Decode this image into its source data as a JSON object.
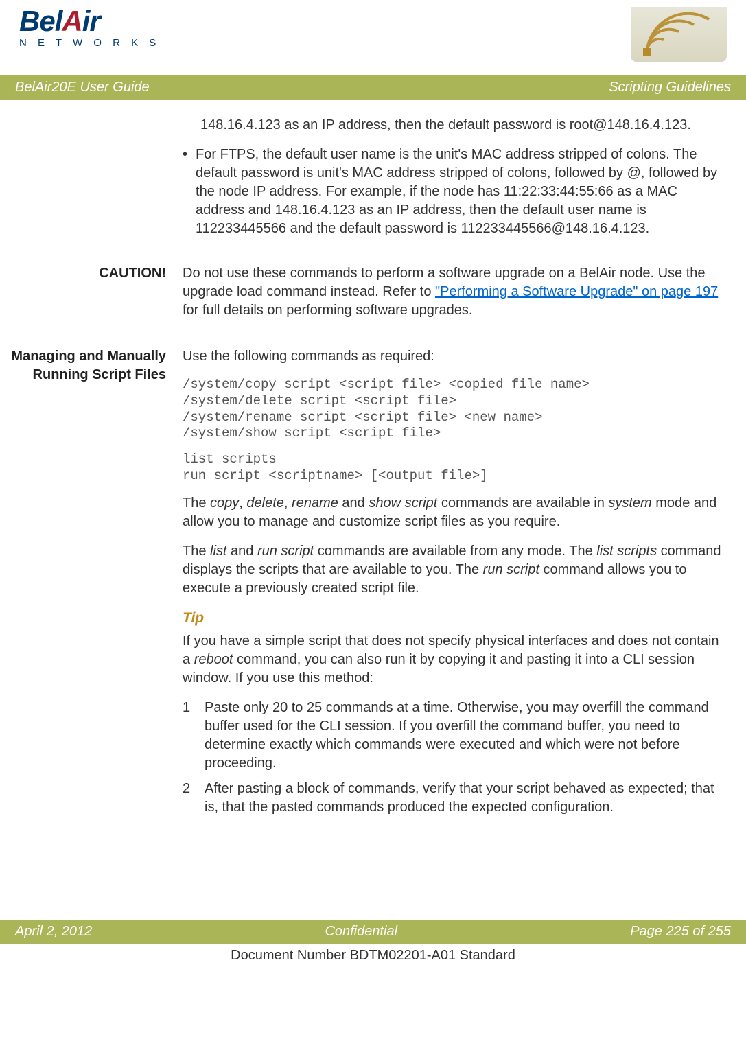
{
  "logo": {
    "main": "BelAir",
    "sub": "N E T W O R K S"
  },
  "titlebar": {
    "left": "BelAir20E User Guide",
    "right": "Scripting Guidelines"
  },
  "intro_para": "148.16.4.123 as an IP address, then the default password is root@148.16.4.123.",
  "ftps_bullet": "For FTPS, the default user name is the unit's MAC address stripped of colons. The default password is unit's MAC address stripped of colons, followed by @, followed by the node IP address. For example, if the node has 11:22:33:44:55:66 as a MAC address and 148.16.4.123 as an IP address, then the default user name is 112233445566 and the default password is 112233445566@148.16.4.123.",
  "caution": {
    "label": "CAUTION!",
    "text_before_link": "Do not use these commands to perform a software upgrade on a BelAir node. Use the upgrade load command instead. Refer to ",
    "link_text": "\"Performing a Software Upgrade\" on page 197",
    "text_after_link": " for full details on performing software upgrades."
  },
  "section": {
    "label": "Managing and Manually Running Script Files",
    "lead": "Use the following commands as required:",
    "code1": "/system/copy script <script file> <copied file name>\n/system/delete script <script file>\n/system/rename script <script file> <new name>\n/system/show script <script file>",
    "code2": "list scripts\nrun script <scriptname> [<output_file>]",
    "p1": {
      "a": "The ",
      "b": "copy",
      "c": ", ",
      "d": "delete",
      "e": ", ",
      "f": "rename",
      "g": " and ",
      "h": "show script",
      "i": " commands are available in ",
      "j": "system",
      "k": " mode and allow you to manage and customize script files as you require."
    },
    "p2": {
      "a": "The ",
      "b": "list",
      "c": " and ",
      "d": "run script",
      "e": " commands are available from any mode. The ",
      "f": "list scripts",
      "g": " command displays the scripts that are available to you. The ",
      "h": "run script",
      "i": " command allows you to execute a previously created script file."
    },
    "tip_heading": "Tip",
    "tip_para": {
      "a": "If you have a simple script that does not specify physical interfaces and does not contain a ",
      "b": "reboot",
      "c": " command, you can also run it by copying it and pasting it into a CLI session window. If you use this method:"
    },
    "steps": [
      {
        "n": "1",
        "t": "Paste only 20 to 25 commands at a time. Otherwise, you may overfill the command buffer used for the CLI session. If you overfill the command buffer, you need to determine exactly which commands were executed and which were not before proceeding."
      },
      {
        "n": "2",
        "t": "After pasting a block of commands, verify that your script behaved as expected; that is, that the pasted commands produced the expected configuration."
      }
    ]
  },
  "footerbar": {
    "left": "April 2, 2012",
    "center": "Confidential",
    "right": "Page 225 of 255"
  },
  "docfooter": "Document Number BDTM02201-A01 Standard"
}
